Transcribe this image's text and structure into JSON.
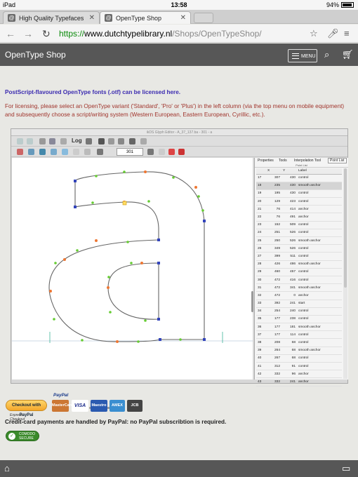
{
  "status_bar": {
    "device": "iPad",
    "time": "13:58",
    "battery": "94%"
  },
  "browser": {
    "tabs": [
      {
        "label": "High Quality Typefaces",
        "active": false
      },
      {
        "label": "OpenType Shop",
        "active": true
      }
    ],
    "url_scheme": "https://",
    "url_domain": "www.dutchtypelibrary.nl",
    "url_path": "/Shops/OpenTypeShop/"
  },
  "header": {
    "title": "OpenType Shop",
    "menu_label": "MENU"
  },
  "intro": {
    "heading": "PostScript-flavoured OpenType fonts (.otf) can be licensed here.",
    "body": "For licensing, please select an OpenType variant ('Standard', 'Pro' or 'Plus') in the left column (via the top menu on mobile equipment) and subsequently choose a script/writing system (Western European, Eastern European, Cyrillic, etc.)."
  },
  "editor": {
    "window_title": "ikDS Glyph Editor - A_37_137.ba - 301 - a",
    "glyph_number": "301",
    "toolbar_log": "Log",
    "panel_tabs": [
      "Properties",
      "Tools",
      "Interpolation Tool",
      "Point List"
    ],
    "panel_title": "Point List",
    "columns": [
      "",
      "X",
      "Y",
      "Label"
    ],
    "rows": [
      [
        "17",
        "307",
        "430",
        "control"
      ],
      [
        "18",
        "235",
        "430",
        "smooth anchor"
      ],
      [
        "19",
        "195",
        "430",
        "control"
      ],
      [
        "20",
        "129",
        "423",
        "control"
      ],
      [
        "21",
        "76",
        "414",
        "anchor"
      ],
      [
        "22",
        "76",
        "491",
        "anchor"
      ],
      [
        "23",
        "152",
        "509",
        "control"
      ],
      [
        "24",
        "251",
        "526",
        "control"
      ],
      [
        "25",
        "250",
        "526",
        "smooth anchor"
      ],
      [
        "26",
        "349",
        "526",
        "control"
      ],
      [
        "27",
        "399",
        "511",
        "control"
      ],
      [
        "28",
        "426",
        "486",
        "smooth anchor"
      ],
      [
        "29",
        "460",
        "457",
        "control"
      ],
      [
        "30",
        "472",
        "416",
        "control"
      ],
      [
        "31",
        "472",
        "341",
        "smooth anchor"
      ],
      [
        "32",
        "472",
        "0",
        "anchor"
      ],
      [
        "33",
        "392",
        "241",
        "start"
      ],
      [
        "34",
        "254",
        "240",
        "control"
      ],
      [
        "35",
        "177",
        "238",
        "control"
      ],
      [
        "36",
        "177",
        "181",
        "smooth anchor"
      ],
      [
        "37",
        "177",
        "114",
        "control"
      ],
      [
        "38",
        "208",
        "68",
        "control"
      ],
      [
        "39",
        "264",
        "68",
        "smooth anchor"
      ],
      [
        "40",
        "267",
        "68",
        "control"
      ],
      [
        "41",
        "312",
        "91",
        "control"
      ],
      [
        "42",
        "332",
        "96",
        "anchor"
      ],
      [
        "43",
        "332",
        "241",
        "anchor"
      ]
    ]
  },
  "payment": {
    "checkout_label": "Checkout with PayPal",
    "express_label": "Express Checkout",
    "paypal_small": "PayPal",
    "cards": [
      "MasterCard",
      "VISA",
      "Maestro",
      "AMEX",
      "JCB"
    ],
    "note": "Credit-card payments are handled by PayPal: no PayPal subscribtion is required.",
    "secure_badge": "COMODO SECURE"
  },
  "colors": {
    "header_bg": "#575757",
    "intro_blue": "#3b2bb0",
    "intro_red": "#a0342c",
    "url_green": "#0a8a0a"
  }
}
